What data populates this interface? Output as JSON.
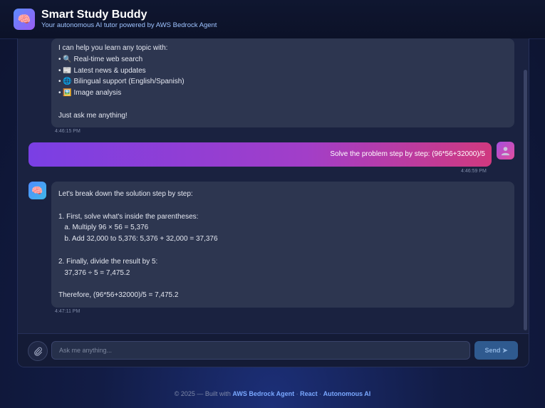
{
  "header": {
    "logo_icon": "🧠",
    "title": "Smart Study Buddy",
    "subtitle": "Your autonomous AI tutor powered by AWS Bedrock Agent"
  },
  "messages": {
    "welcome": {
      "lines": [
        "I can help you learn any topic with:",
        "• 🔍 Real-time web search",
        "• 📰 Latest news & updates",
        "• 🌐 Bilingual support (English/Spanish)",
        "• 🖼️ Image analysis",
        "",
        "Just ask me anything!"
      ],
      "time": "4:46:15 PM"
    },
    "user": {
      "text": "Solve the problem step by step: (96*56+32000)/5",
      "time": "4:46:59 PM"
    },
    "answer": {
      "avatar_icon": "🧠",
      "lines": [
        "Let's break down the solution step by step:",
        "",
        "1. First, solve what's inside the parentheses:",
        "   a. Multiply 96 × 56 = 5,376",
        "   b. Add 32,000 to 5,376: 5,376 + 32,000 = 37,376",
        "",
        "2. Finally, divide the result by 5:",
        "   37,376 ÷ 5 = 7,475.2",
        "",
        "Therefore, (96*56+32000)/5 = 7,475.2"
      ],
      "time": "4:47:11 PM"
    }
  },
  "input": {
    "attach_icon": "paperclip-icon",
    "placeholder": "Ask me anything...",
    "send_label": "Send ➤"
  },
  "footer": {
    "prefix": "© 2025 — Built with ",
    "link1": "AWS Bedrock Agent",
    "sep1": " · ",
    "link2": "React",
    "sep2": " · ",
    "link3": "Autonomous AI"
  }
}
